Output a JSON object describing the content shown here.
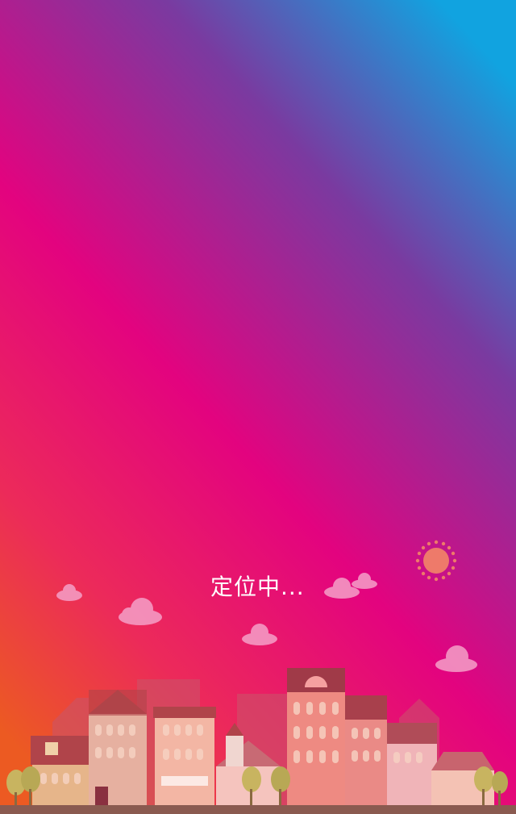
{
  "loading": {
    "status_text": "定位中..."
  },
  "colors": {
    "gradient_top": "#11a3e0",
    "gradient_mid": "#e3037f",
    "gradient_bottom": "#ec5a22",
    "sun": "#ee7a6a",
    "cloud": "#f5a0c8"
  },
  "icons": [
    "sun-icon",
    "cloud-icon",
    "tree-icon"
  ]
}
